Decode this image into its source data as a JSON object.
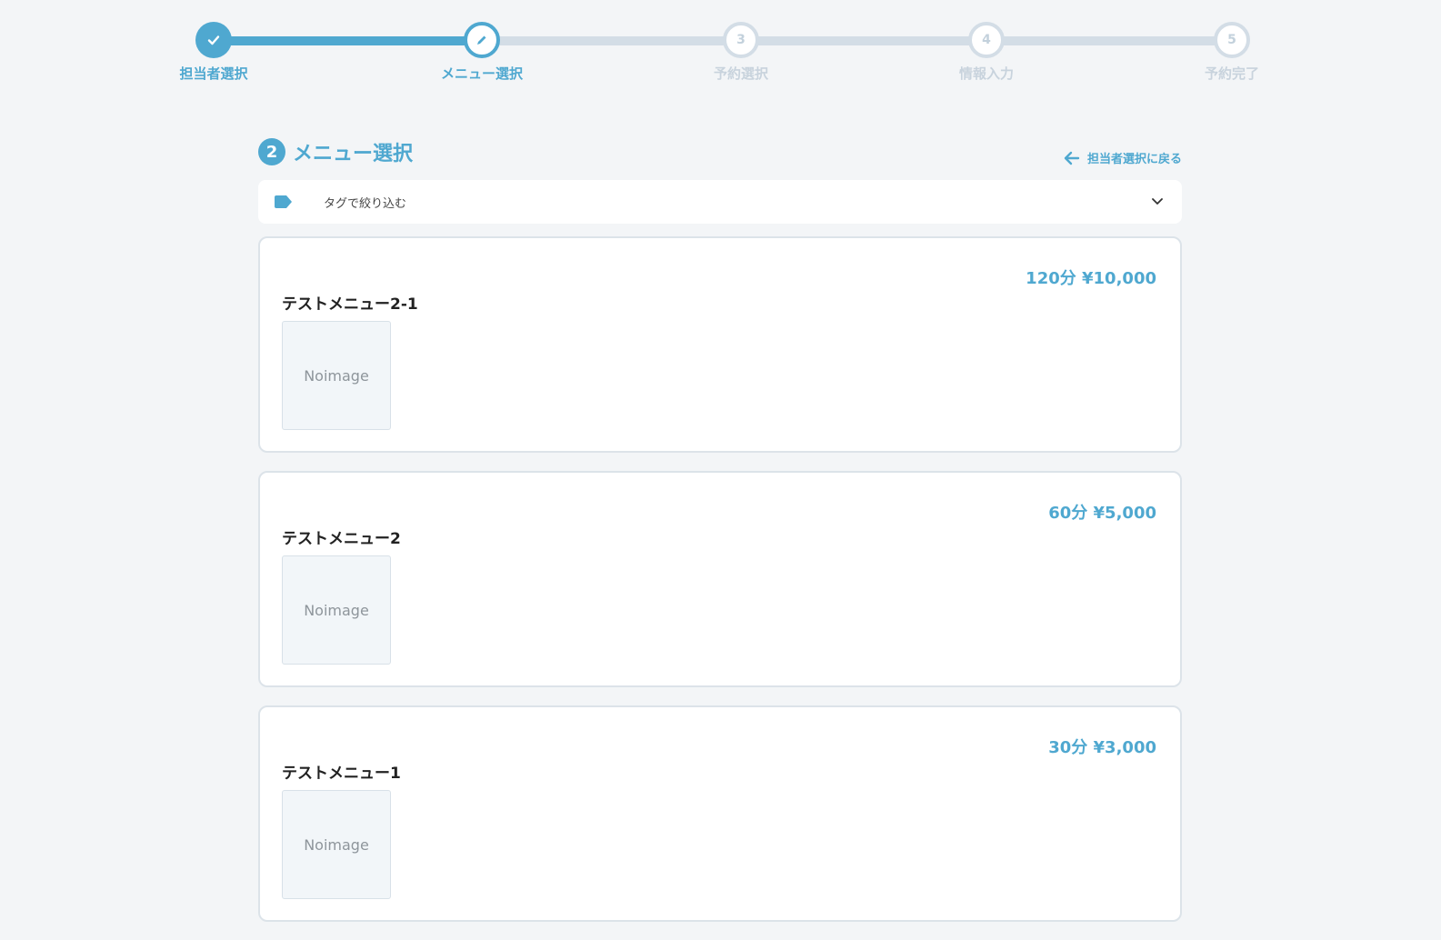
{
  "steps": [
    {
      "number": "",
      "label": "担当者選択",
      "state": "done"
    },
    {
      "number": "",
      "label": "メニュー選択",
      "state": "current"
    },
    {
      "number": "3",
      "label": "予約選択",
      "state": "todo"
    },
    {
      "number": "4",
      "label": "情報入力",
      "state": "todo"
    },
    {
      "number": "5",
      "label": "予約完了",
      "state": "todo"
    }
  ],
  "section": {
    "number": "2",
    "title": "メニュー選択",
    "back_label": "担当者選択に戻る"
  },
  "filter": {
    "label": "タグで絞り込む"
  },
  "menus": [
    {
      "name": "テストメニュー2-1",
      "price": "120分 ¥10,000",
      "image_text": "Noimage"
    },
    {
      "name": "テストメニュー2",
      "price": "60分 ¥5,000",
      "image_text": "Noimage"
    },
    {
      "name": "テストメニュー1",
      "price": "30分 ¥3,000",
      "image_text": "Noimage"
    }
  ],
  "colors": {
    "accent": "#4fa8d0",
    "inactive": "#d3dde6",
    "background": "#f3f5f7"
  }
}
